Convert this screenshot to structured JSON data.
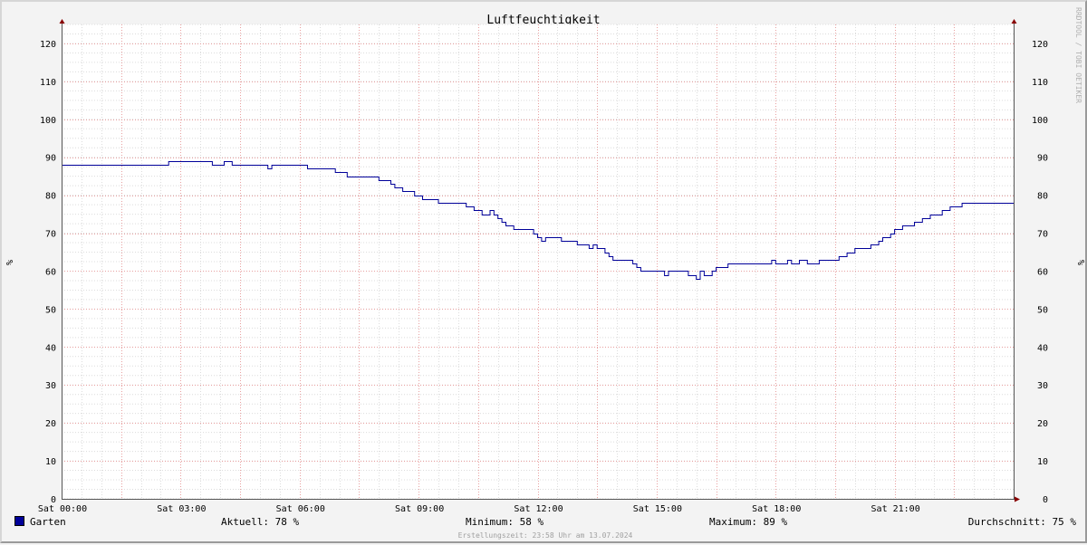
{
  "chart_data": {
    "type": "line",
    "title": "Luftfeuchtigkeit",
    "ylabel": "%",
    "ylim": [
      0,
      125
    ],
    "yticks": [
      0,
      10,
      20,
      30,
      40,
      50,
      60,
      70,
      80,
      90,
      100,
      110,
      120
    ],
    "x_range_hours": [
      0,
      24
    ],
    "xticks": [
      {
        "h": 0,
        "label": "Sat 00:00"
      },
      {
        "h": 3,
        "label": "Sat 03:00"
      },
      {
        "h": 6,
        "label": "Sat 06:00"
      },
      {
        "h": 9,
        "label": "Sat 09:00"
      },
      {
        "h": 12,
        "label": "Sat 12:00"
      },
      {
        "h": 15,
        "label": "Sat 15:00"
      },
      {
        "h": 18,
        "label": "Sat 18:00"
      },
      {
        "h": 21,
        "label": "Sat 21:00"
      }
    ],
    "grid": true,
    "legend_placement": "bottom",
    "series": [
      {
        "name": "Garten",
        "color": "#000099",
        "points": [
          [
            0,
            88
          ],
          [
            2.7,
            88
          ],
          [
            2.7,
            89
          ],
          [
            3.8,
            89
          ],
          [
            3.8,
            88
          ],
          [
            4.1,
            88
          ],
          [
            4.1,
            89
          ],
          [
            4.3,
            89
          ],
          [
            4.3,
            88
          ],
          [
            5.2,
            88
          ],
          [
            5.2,
            87
          ],
          [
            5.3,
            87
          ],
          [
            5.3,
            88
          ],
          [
            6.2,
            88
          ],
          [
            6.2,
            87
          ],
          [
            6.9,
            87
          ],
          [
            6.9,
            86
          ],
          [
            7.2,
            86
          ],
          [
            7.2,
            85
          ],
          [
            8.0,
            85
          ],
          [
            8.0,
            84
          ],
          [
            8.3,
            84
          ],
          [
            8.3,
            83
          ],
          [
            8.4,
            83
          ],
          [
            8.4,
            82
          ],
          [
            8.6,
            82
          ],
          [
            8.6,
            81
          ],
          [
            8.9,
            81
          ],
          [
            8.9,
            80
          ],
          [
            9.1,
            80
          ],
          [
            9.1,
            79
          ],
          [
            9.5,
            79
          ],
          [
            9.5,
            78
          ],
          [
            10.2,
            78
          ],
          [
            10.2,
            77
          ],
          [
            10.4,
            77
          ],
          [
            10.4,
            76
          ],
          [
            10.6,
            76
          ],
          [
            10.6,
            75
          ],
          [
            10.8,
            75
          ],
          [
            10.8,
            76
          ],
          [
            10.9,
            76
          ],
          [
            10.9,
            75
          ],
          [
            11.0,
            75
          ],
          [
            11.0,
            74
          ],
          [
            11.1,
            74
          ],
          [
            11.1,
            73
          ],
          [
            11.2,
            73
          ],
          [
            11.2,
            72
          ],
          [
            11.4,
            72
          ],
          [
            11.4,
            71
          ],
          [
            11.9,
            71
          ],
          [
            11.9,
            70
          ],
          [
            12.0,
            70
          ],
          [
            12.0,
            69
          ],
          [
            12.1,
            69
          ],
          [
            12.1,
            68
          ],
          [
            12.2,
            68
          ],
          [
            12.2,
            69
          ],
          [
            12.6,
            69
          ],
          [
            12.6,
            68
          ],
          [
            13.0,
            68
          ],
          [
            13.0,
            67
          ],
          [
            13.3,
            67
          ],
          [
            13.3,
            66
          ],
          [
            13.4,
            66
          ],
          [
            13.4,
            67
          ],
          [
            13.5,
            67
          ],
          [
            13.5,
            66
          ],
          [
            13.7,
            66
          ],
          [
            13.7,
            65
          ],
          [
            13.8,
            65
          ],
          [
            13.8,
            64
          ],
          [
            13.9,
            64
          ],
          [
            13.9,
            63
          ],
          [
            14.4,
            63
          ],
          [
            14.4,
            62
          ],
          [
            14.5,
            62
          ],
          [
            14.5,
            61
          ],
          [
            14.6,
            61
          ],
          [
            14.6,
            60
          ],
          [
            15.2,
            60
          ],
          [
            15.2,
            59
          ],
          [
            15.3,
            59
          ],
          [
            15.3,
            60
          ],
          [
            15.8,
            60
          ],
          [
            15.8,
            59
          ],
          [
            16.0,
            59
          ],
          [
            16.0,
            58
          ],
          [
            16.1,
            58
          ],
          [
            16.1,
            60
          ],
          [
            16.2,
            60
          ],
          [
            16.2,
            59
          ],
          [
            16.4,
            59
          ],
          [
            16.4,
            60
          ],
          [
            16.5,
            60
          ],
          [
            16.5,
            61
          ],
          [
            16.8,
            61
          ],
          [
            16.8,
            62
          ],
          [
            17.9,
            62
          ],
          [
            17.9,
            63
          ],
          [
            18.0,
            63
          ],
          [
            18.0,
            62
          ],
          [
            18.3,
            62
          ],
          [
            18.3,
            63
          ],
          [
            18.4,
            63
          ],
          [
            18.4,
            62
          ],
          [
            18.6,
            62
          ],
          [
            18.6,
            63
          ],
          [
            18.8,
            63
          ],
          [
            18.8,
            62
          ],
          [
            19.1,
            62
          ],
          [
            19.1,
            63
          ],
          [
            19.6,
            63
          ],
          [
            19.6,
            64
          ],
          [
            19.8,
            64
          ],
          [
            19.8,
            65
          ],
          [
            20.0,
            65
          ],
          [
            20.0,
            66
          ],
          [
            20.4,
            66
          ],
          [
            20.4,
            67
          ],
          [
            20.6,
            67
          ],
          [
            20.6,
            68
          ],
          [
            20.7,
            68
          ],
          [
            20.7,
            69
          ],
          [
            20.9,
            69
          ],
          [
            20.9,
            70
          ],
          [
            21.0,
            70
          ],
          [
            21.0,
            71
          ],
          [
            21.2,
            71
          ],
          [
            21.2,
            72
          ],
          [
            21.5,
            72
          ],
          [
            21.5,
            73
          ],
          [
            21.7,
            73
          ],
          [
            21.7,
            74
          ],
          [
            21.9,
            74
          ],
          [
            21.9,
            75
          ],
          [
            22.2,
            75
          ],
          [
            22.2,
            76
          ],
          [
            22.4,
            76
          ],
          [
            22.4,
            77
          ],
          [
            22.7,
            77
          ],
          [
            22.7,
            78
          ],
          [
            24.0,
            78
          ]
        ]
      }
    ]
  },
  "legend": {
    "series_name": "Garten",
    "current": "Aktuell:  78 %",
    "minimum": "Minimum:  58 %",
    "maximum": "Maximum:  89 %",
    "average": "Durchschnitt:  75 %"
  },
  "watermark": "RRDTOOL / TOBI OETIKER",
  "footer": "Erstellungszeit: 23:58 Uhr am 13.07.2024"
}
